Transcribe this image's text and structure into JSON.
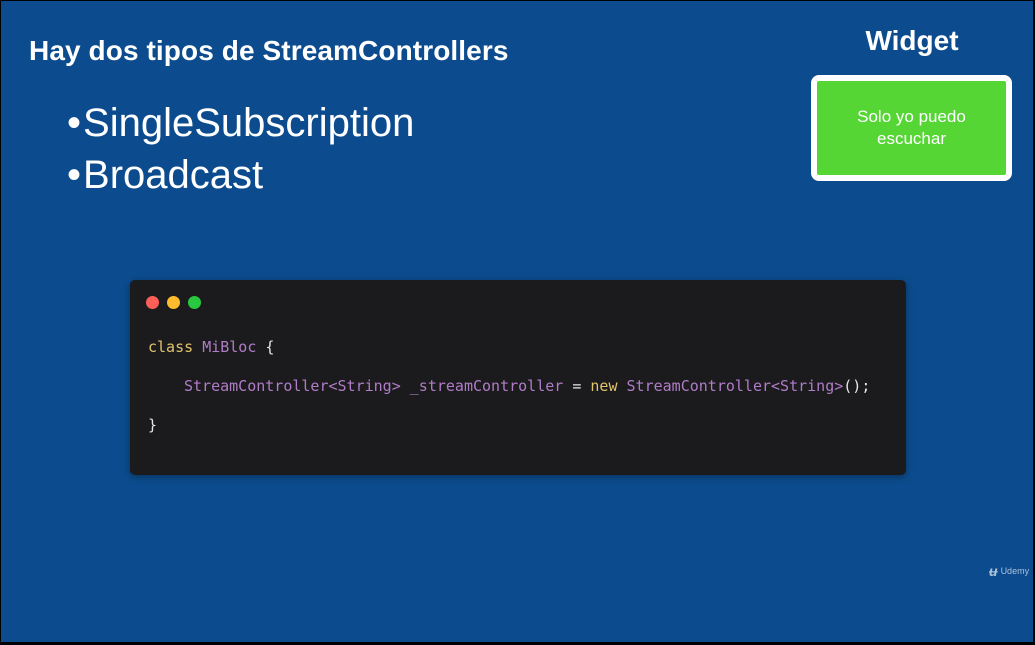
{
  "slide": {
    "title": "Hay dos tipos de StreamControllers",
    "bullets": [
      {
        "dot": "•",
        "text": "SingleSubscription"
      },
      {
        "dot": "•",
        "text": "Broadcast"
      }
    ]
  },
  "widget": {
    "label": "Widget",
    "box_text": "Solo yo puedo escuchar",
    "box_color": "#56d635"
  },
  "code": {
    "window_dots": [
      "#fc5f57",
      "#fdbc2e",
      "#28c840"
    ],
    "line1": {
      "keyword": "class",
      "name": "MiBloc",
      "brace": "{"
    },
    "line2": {
      "type1": "StreamController<String>",
      "var": "_streamController",
      "eq": "=",
      "keyword": "new",
      "type2": "StreamController<String>",
      "tail": "();"
    },
    "line3": {
      "brace": "}"
    }
  },
  "watermark": {
    "icon": "udemy-logo-icon",
    "text": "Udemy"
  },
  "colors": {
    "background": "#0c4c8e",
    "code_background": "#1b1b1d"
  }
}
